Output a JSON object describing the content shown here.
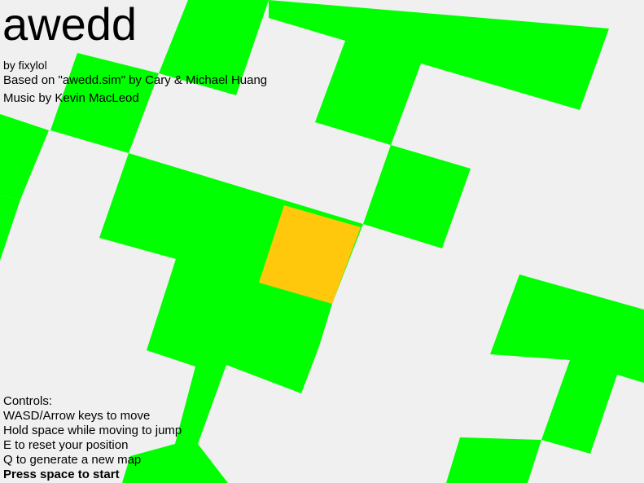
{
  "game": {
    "title": "awedd",
    "author": "by fixylol",
    "based_on": "Based on \"awedd.sim\" by Cary & Michael Huang",
    "music": "Music by Kevin MacLeod",
    "controls_heading": "Controls:",
    "controls": [
      "WASD/Arrow keys to move",
      "Hold space while moving to jump",
      "E to reset your position",
      "Q to generate a new map"
    ],
    "start_prompt": "Press space to start"
  },
  "colors": {
    "background": "#f0f0f0",
    "tile": "#00ff00",
    "player": "#ffc80c"
  }
}
